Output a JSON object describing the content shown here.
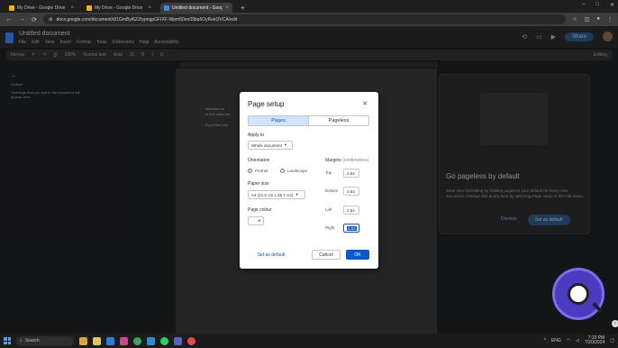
{
  "browser": {
    "tabs": [
      {
        "title": "My Drive - Google Drive",
        "active": false,
        "icon": "drive-icon"
      },
      {
        "title": "My Drive - Google Drive",
        "active": false,
        "icon": "drive-icon"
      },
      {
        "title": "Untitled document - Google D",
        "active": true,
        "icon": "docs-icon"
      }
    ],
    "new_tab": "+",
    "url": "docs.google.com/document/d/1GmByt6ZZtypngpGFIXF-Wpm50on09ba5OyRekOVCA/edit"
  },
  "docs": {
    "title": "Untitled document",
    "menus": [
      "File",
      "Edit",
      "View",
      "Insert",
      "Format",
      "Tools",
      "Extensions",
      "Help",
      "Accessibility"
    ],
    "share_label": "Share",
    "toolbar": {
      "menus_label": "Menus",
      "zoom": "100%",
      "style": "Normal text",
      "font": "Arial",
      "font_size": "11",
      "mode": "Editing"
    },
    "outline": {
      "heading": "Outline",
      "hint": "Headings that you add to the document will appear here."
    },
    "page_text": [
      "Welcome to",
      "In this video we",
      "If you find this"
    ]
  },
  "pageless_panel": {
    "title": "Go pageless by default",
    "body": "Save time formatting by making pageless your default for every new document. Change this at any time by selecting Page setup in the File menu.",
    "dismiss": "Dismiss",
    "set_default": "Set as default"
  },
  "dialog": {
    "title": "Page setup",
    "tabs": [
      {
        "label": "Pages",
        "selected": true
      },
      {
        "label": "Pageless",
        "selected": false
      }
    ],
    "apply_to_label": "Apply to",
    "apply_to_value": "Whole document",
    "orientation_label": "Orientation",
    "orientation_options": [
      {
        "label": "Portrait",
        "selected": true
      },
      {
        "label": "Landscape",
        "selected": false
      }
    ],
    "paper_size_label": "Paper size",
    "paper_size_value": "A4 (21.0 cm x 29.7 cm)",
    "page_colour_label": "Page colour",
    "margins_label": "Margins",
    "margins_unit": "(centimetres)",
    "margins": [
      {
        "label": "Top",
        "value": "2.54"
      },
      {
        "label": "Bottom",
        "value": "2.54"
      },
      {
        "label": "Left",
        "value": "2.54"
      },
      {
        "label": "Right",
        "value": "2.54"
      }
    ],
    "set_default_label": "Set as default",
    "cancel_label": "Cancel",
    "ok_label": "OK",
    "accent": "#0b57d0"
  },
  "taskbar": {
    "search_placeholder": "Search",
    "language": "ENG",
    "time": "7:10 PM",
    "date": "7/20/2024"
  }
}
